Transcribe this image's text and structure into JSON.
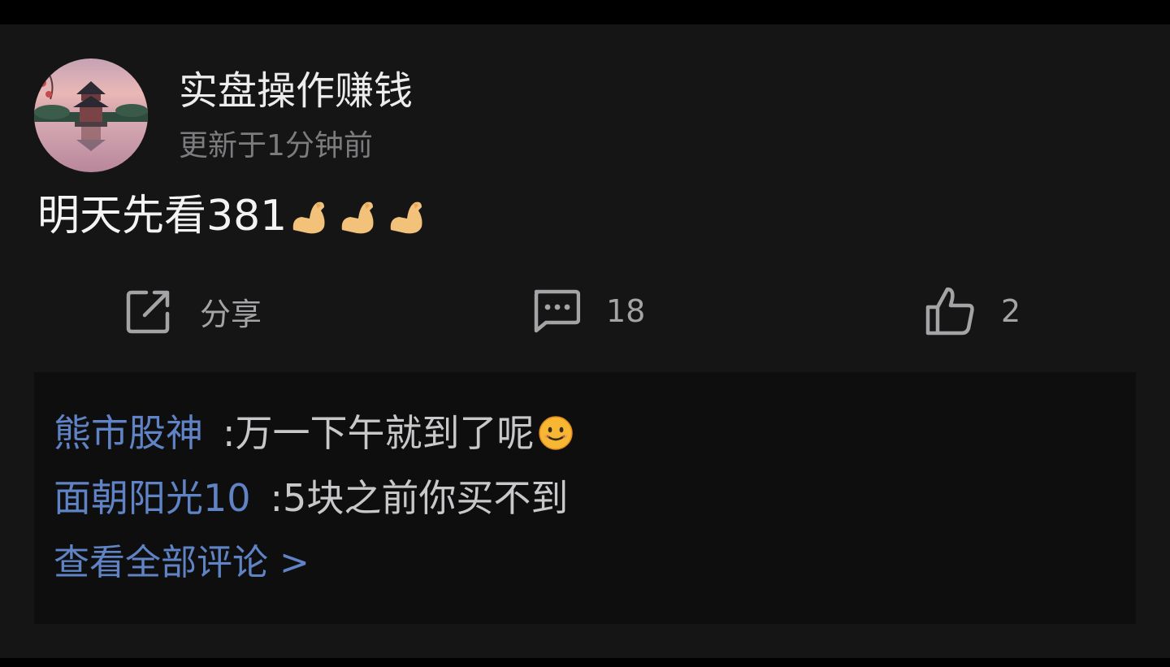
{
  "post": {
    "author": "实盘操作赚钱",
    "timestamp": "更新于1分钟前",
    "text": "明天先看381",
    "emojis": [
      "flexed-biceps",
      "flexed-biceps",
      "flexed-biceps"
    ]
  },
  "actions": {
    "share_label": "分享",
    "comment_count": "18",
    "like_count": "2"
  },
  "comments": [
    {
      "author": "熊市股神",
      "separator": ":",
      "text": "万一下午就到了呢",
      "emoji": "smiling-face"
    },
    {
      "author": "面朝阳光10",
      "separator": ":",
      "text": "5块之前你买不到"
    }
  ],
  "view_all_label": "查看全部评论 >",
  "colors": {
    "background": "#000000",
    "card": "#151516",
    "comments_box": "#0e0e0f",
    "link": "#5f83c4",
    "muted": "#7c7c7e"
  }
}
